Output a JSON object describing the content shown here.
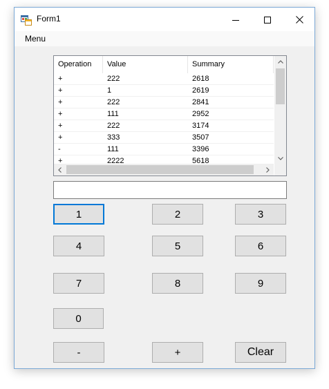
{
  "window": {
    "title": "Form1"
  },
  "menu": {
    "items": [
      {
        "label": "Menu"
      }
    ]
  },
  "list": {
    "columns": [
      "Operation",
      "Value",
      "Summary"
    ],
    "rows": [
      {
        "op": "+",
        "value": "222",
        "summary": "2618"
      },
      {
        "op": "+",
        "value": "1",
        "summary": "2619"
      },
      {
        "op": "+",
        "value": "222",
        "summary": "2841"
      },
      {
        "op": "+",
        "value": "111",
        "summary": "2952"
      },
      {
        "op": "+",
        "value": "222",
        "summary": "3174"
      },
      {
        "op": "+",
        "value": "333",
        "summary": "3507"
      },
      {
        "op": "-",
        "value": "111",
        "summary": "3396"
      },
      {
        "op": "+",
        "value": "2222",
        "summary": "5618"
      }
    ]
  },
  "input": {
    "value": ""
  },
  "buttons": {
    "one": "1",
    "two": "2",
    "three": "3",
    "four": "4",
    "five": "5",
    "six": "6",
    "seven": "7",
    "eight": "8",
    "nine": "9",
    "zero": "0",
    "minus": "-",
    "plus": "+",
    "clear": "Clear"
  },
  "colors": {
    "focus_border": "#0078d7",
    "button_bg": "#e1e1e1",
    "window_border": "#7aa8d6"
  }
}
